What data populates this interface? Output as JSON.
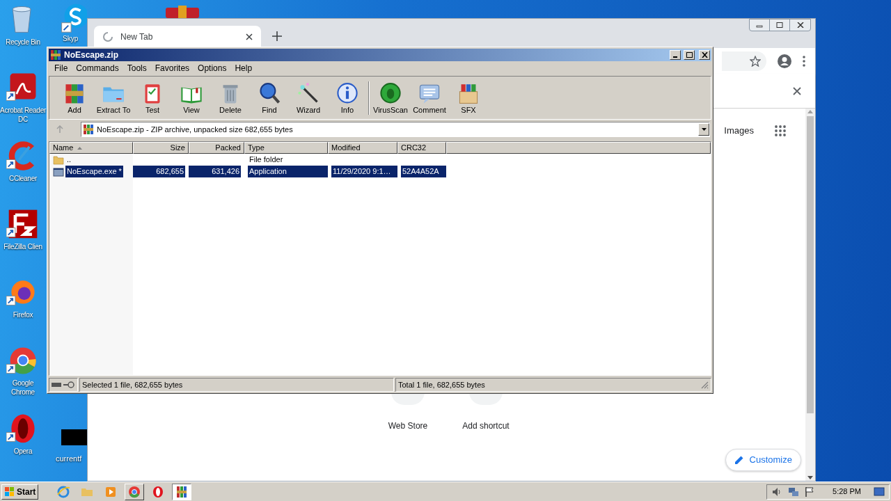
{
  "desktop_icons": [
    {
      "label": "Recycle Bin"
    },
    {
      "label": "Acrobat Reader DC"
    },
    {
      "label": "CCleaner"
    },
    {
      "label": "FileZilla Clien"
    },
    {
      "label": "Firefox"
    },
    {
      "label": "Google Chrome"
    },
    {
      "label": "Opera"
    }
  ],
  "desktop_extra_icons": [
    {
      "label": "Skyp"
    },
    {
      "label": "currentf"
    }
  ],
  "browser": {
    "tab": {
      "title": "New Tab"
    },
    "images_link": "Images",
    "shortcuts": [
      {
        "label": "Web Store"
      },
      {
        "label": "Add shortcut"
      }
    ],
    "customize": "Customize"
  },
  "winrar": {
    "title": "NoEscape.zip",
    "menu": [
      "File",
      "Commands",
      "Tools",
      "Favorites",
      "Options",
      "Help"
    ],
    "toolbar": [
      "Add",
      "Extract To",
      "Test",
      "View",
      "Delete",
      "Find",
      "Wizard",
      "Info",
      "VirusScan",
      "Comment",
      "SFX"
    ],
    "path": "NoEscape.zip - ZIP archive, unpacked size 682,655 bytes",
    "columns": [
      {
        "label": "Name",
        "sorted": true
      },
      {
        "label": "Size",
        "sorted": false
      },
      {
        "label": "Packed",
        "sorted": false
      },
      {
        "label": "Type",
        "sorted": false
      },
      {
        "label": "Modified",
        "sorted": false
      },
      {
        "label": "CRC32",
        "sorted": false
      }
    ],
    "rows": [
      {
        "kind": "folder",
        "name": "..",
        "type": "File folder",
        "selected": false
      },
      {
        "kind": "file",
        "name": "NoEscape.exe *",
        "size": "682,655",
        "packed": "631,426",
        "type": "Application",
        "modified": "11/29/2020 9:1…",
        "crc32": "52A4A52A",
        "selected": true
      }
    ],
    "status_left": "Selected 1 file, 682,655 bytes",
    "status_right": "Total 1 file, 682,655 bytes"
  },
  "taskbar": {
    "start": "Start",
    "items": [
      {
        "running": false,
        "selected": false
      },
      {
        "running": false,
        "selected": false
      },
      {
        "running": false,
        "selected": false
      },
      {
        "running": true,
        "selected": false
      },
      {
        "running": false,
        "selected": false
      },
      {
        "running": true,
        "selected": true
      }
    ],
    "clock": "5:28 PM"
  }
}
